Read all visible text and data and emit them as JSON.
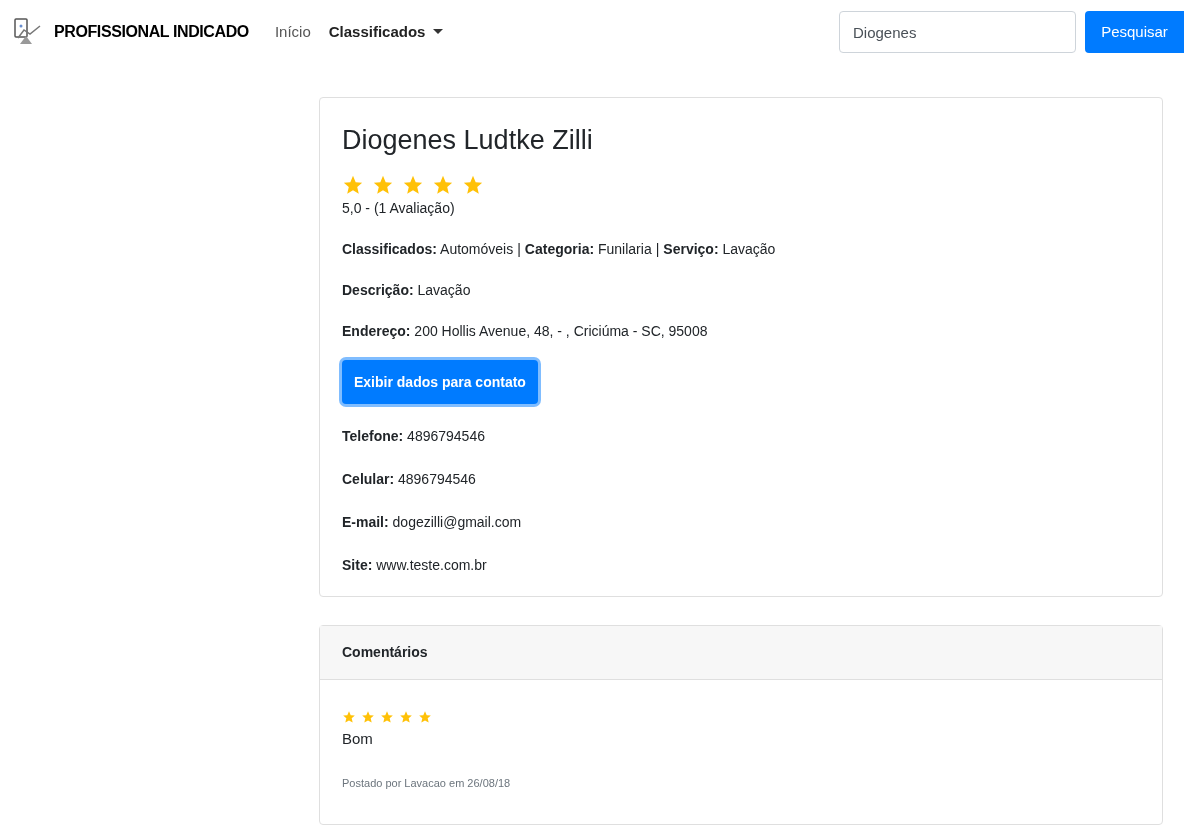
{
  "navbar": {
    "brand": "PROFISSIONAL INDICADO",
    "links": [
      {
        "label": "Início",
        "active": false,
        "dropdown": false
      },
      {
        "label": "Classificados",
        "active": true,
        "dropdown": true
      }
    ],
    "search": {
      "value": "Diogenes",
      "button": "Pesquisar"
    }
  },
  "profile": {
    "name": "Diogenes Ludtke Zilli",
    "stars": 5,
    "rating": "5,0 - (1 Avaliação)",
    "info_lines": [
      [
        {
          "label": "Classificados:",
          "value": "Automóveis"
        },
        {
          "label": "Categoria:",
          "value": "Funilaria"
        },
        {
          "label": "Serviço:",
          "value": "Lavação"
        }
      ],
      [
        {
          "label": "Descrição:",
          "value": "Lavação"
        }
      ],
      [
        {
          "label": "Endereço:",
          "value": "200 Hollis Avenue, 48, - , Criciúma - SC, 95008"
        }
      ]
    ],
    "separator": "|",
    "contact_button": "Exibir dados para contato",
    "contact_lines": [
      {
        "label": "Telefone:",
        "value": "4896794546"
      },
      {
        "label": "Celular:",
        "value": "4896794546"
      },
      {
        "label": "E-mail:",
        "value": "dogezilli@gmail.com"
      },
      {
        "label": "Site:",
        "value": "www.teste.com.br"
      }
    ]
  },
  "comments": {
    "title": "Comentários",
    "items": [
      {
        "stars": 5,
        "text": "Bom",
        "meta": "Postado por Lavacao em 26/08/18"
      }
    ]
  }
}
